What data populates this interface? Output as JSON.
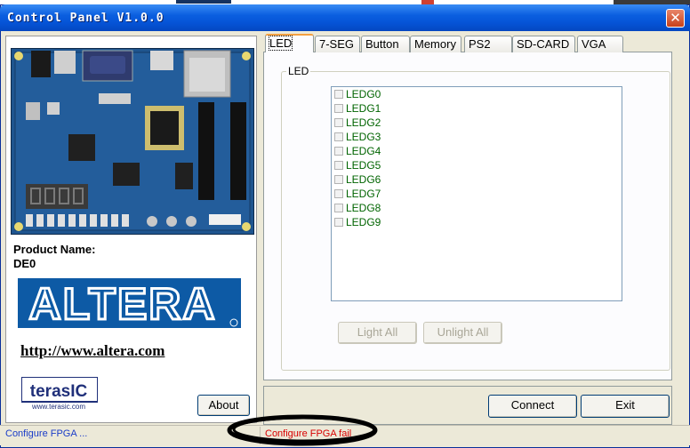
{
  "window": {
    "title": "Control Panel V1.0.0",
    "close_glyph": "✕"
  },
  "left": {
    "product_label": "Product Name:",
    "product_value": "DE0",
    "altera_logo_text": "ALTERA",
    "altera_link": "http://www.altera.com",
    "terasic_logo_text": "terasIC",
    "terasic_logo_url": "www.terasic.com",
    "about_label": "About"
  },
  "tabs": [
    {
      "label": "LED",
      "active": true
    },
    {
      "label": "7-SEG"
    },
    {
      "label": "Button"
    },
    {
      "label": "Memory"
    },
    {
      "label": "PS2"
    },
    {
      "label": "SD-CARD"
    },
    {
      "label": "VGA"
    }
  ],
  "led_panel": {
    "group_label": "LED",
    "items": [
      "LEDG0",
      "LEDG1",
      "LEDG2",
      "LEDG3",
      "LEDG4",
      "LEDG5",
      "LEDG6",
      "LEDG7",
      "LEDG8",
      "LEDG9"
    ],
    "light_all": "Light All",
    "unlight_all": "Unlight All"
  },
  "actions": {
    "connect": "Connect",
    "exit": "Exit"
  },
  "status": {
    "left": "Configure FPGA ...",
    "middle": "Configure FPGA fail"
  },
  "colors": {
    "title_bar": "#0553d6",
    "led_text": "#006400",
    "status_fail": "#d80000",
    "status_info": "#1a3cc8",
    "altera_blue": "#0d5aa5"
  },
  "icons": {
    "close": "close-icon",
    "board": "de0-board-image",
    "altera": "altera-logo",
    "terasic": "terasic-logo"
  }
}
